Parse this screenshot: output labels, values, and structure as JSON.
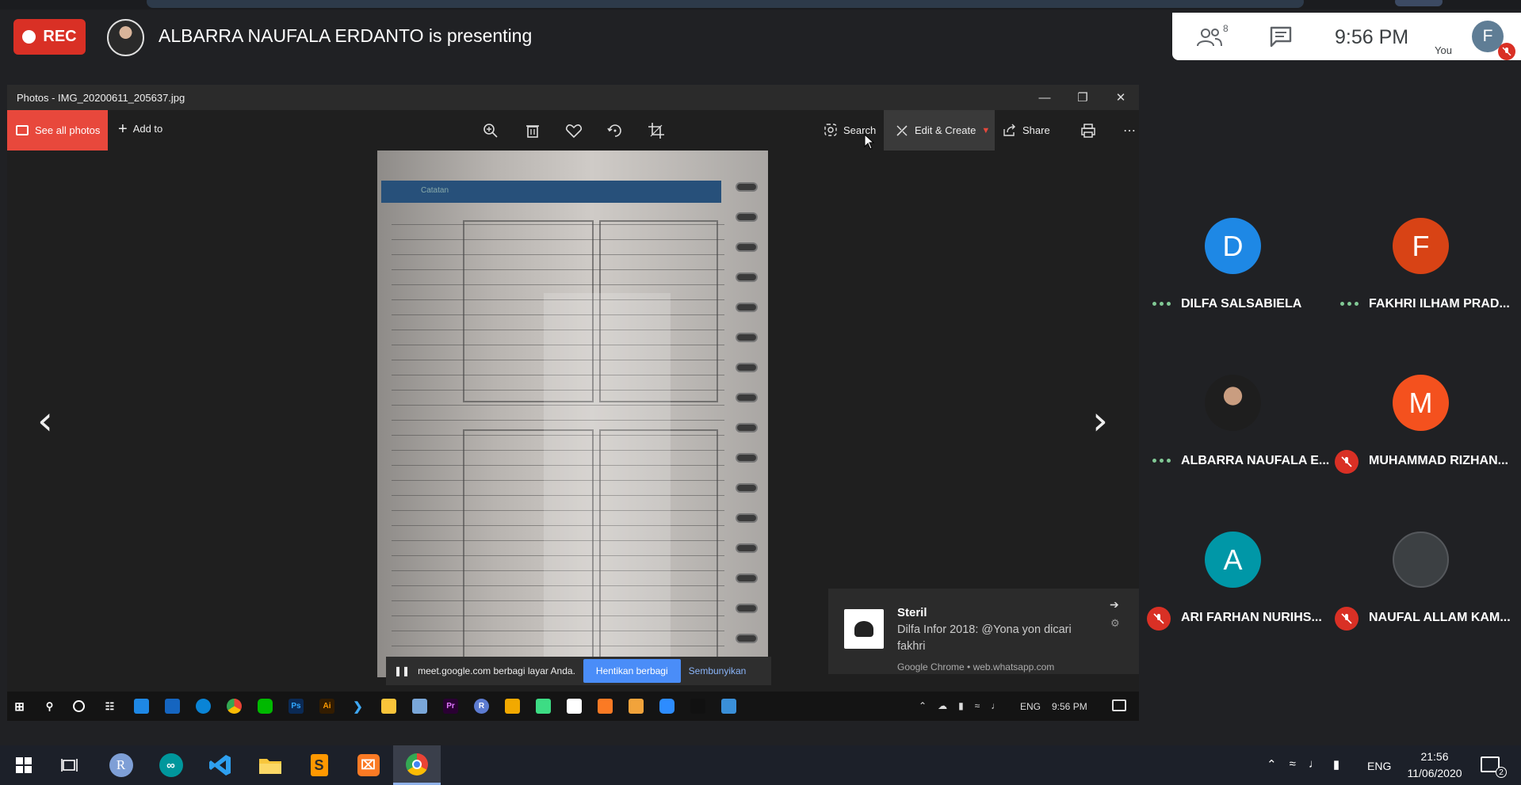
{
  "meet": {
    "rec_label": "REC",
    "presenting_text": "ALBARRA NAUFALA ERDANTO is presenting",
    "participant_count": "8",
    "clock": "9:56 PM",
    "you_label": "You",
    "self_initial": "F",
    "rec_color": "#d93025"
  },
  "photos_app": {
    "window_title": "Photos - IMG_20200611_205637.jpg",
    "see_all_label": "See all photos",
    "add_to_label": "Add to",
    "search_label": "Search",
    "edit_create_label": "Edit & Create",
    "share_label": "Share",
    "accent_color": "#e8483c",
    "notebook_header": "Catatan"
  },
  "share_bar": {
    "message": "meet.google.com berbagi layar Anda.",
    "stop_label": "Hentikan berbagi",
    "hide_label": "Sembunyikan"
  },
  "notification": {
    "title": "Steril",
    "body": "Dilfa Infor 2018: @Yona yon dicari fakhri",
    "source": "Google Chrome • web.whatsapp.com"
  },
  "inner_taskbar": {
    "lang": "ENG",
    "clock": "9:56 PM"
  },
  "participants": [
    {
      "initial": "D",
      "name": "DILFA SALSABIELA",
      "color": "#1e88e5",
      "status": "speaking"
    },
    {
      "initial": "F",
      "name": "FAKHRI ILHAM PRAD...",
      "color": "#d84315",
      "status": "speaking"
    },
    {
      "initial": "",
      "name": "ALBARRA NAUFALA E...",
      "color": "#cfd8dc",
      "status": "speaking"
    },
    {
      "initial": "M",
      "name": "MUHAMMAD RIZHAN...",
      "color": "#f4511e",
      "status": "muted"
    },
    {
      "initial": "A",
      "name": "ARI FARHAN NURIHS...",
      "color": "#0097a7",
      "status": "muted"
    },
    {
      "initial": "",
      "name": "NAUFAL ALLAM KAM...",
      "color": "#3c4043",
      "status": "muted"
    }
  ],
  "outer_taskbar": {
    "lang": "ENG",
    "time": "21:56",
    "date": "11/06/2020",
    "notification_count": "2"
  }
}
